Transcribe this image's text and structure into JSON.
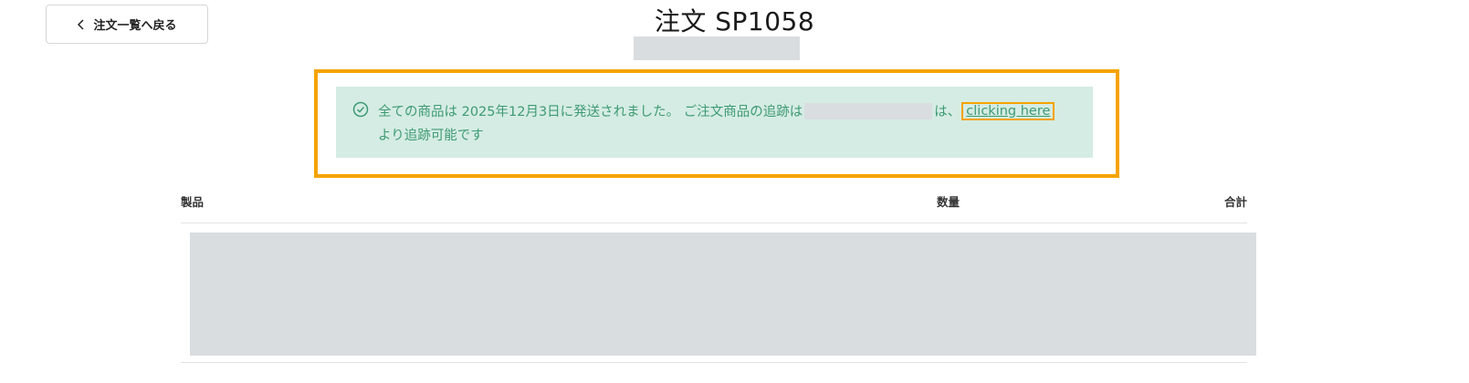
{
  "back_button": {
    "label": "注文一覧へ戻る",
    "icon": "chevron-left-icon"
  },
  "page": {
    "title": "注文 SP1058"
  },
  "notice": {
    "icon": "check-circle-icon",
    "text_before": "全ての商品は 2025年12月3日に発送されました。 ご注文商品の追跡は",
    "text_after": "は、",
    "link_label": "clicking here",
    "line2": "より追跡可能です",
    "highlight_color": "#f5a300",
    "background_color": "#d5ece4",
    "text_color": "#3e9a74"
  },
  "table": {
    "columns": [
      "製品",
      "数量",
      "合計"
    ]
  }
}
